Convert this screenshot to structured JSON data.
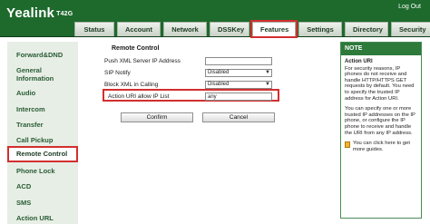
{
  "header": {
    "brand": "Yealink",
    "model": "T42G",
    "logout": "Log Out",
    "tabs": [
      {
        "label": "Status"
      },
      {
        "label": "Account"
      },
      {
        "label": "Network"
      },
      {
        "label": "DSSKey"
      },
      {
        "label": "Features",
        "active": true
      },
      {
        "label": "Settings"
      },
      {
        "label": "Directory"
      },
      {
        "label": "Security"
      }
    ]
  },
  "sidebar": {
    "items": [
      {
        "label": "Forward&DND"
      },
      {
        "label": "General Information"
      },
      {
        "label": "Audio"
      },
      {
        "label": "Intercom"
      },
      {
        "label": "Transfer"
      },
      {
        "label": "Call Pickup"
      },
      {
        "label": "Remote Control",
        "active": true
      },
      {
        "label": "Phone Lock"
      },
      {
        "label": "ACD"
      },
      {
        "label": "SMS"
      },
      {
        "label": "Action URL"
      }
    ]
  },
  "main": {
    "section_title": "Remote Control",
    "fields": {
      "push_xml_label": "Push XML Server IP Address",
      "push_xml_value": "",
      "sip_notify_label": "SIP Notify",
      "sip_notify_value": "Disabled",
      "block_xml_label": "Block XML in Calling",
      "block_xml_value": "Disabled",
      "action_uri_label": "Action URI allow IP List",
      "action_uri_value": "any"
    },
    "confirm_label": "Confirm",
    "cancel_label": "Cancel"
  },
  "note": {
    "header": "NOTE",
    "title": "Action URI",
    "para1": "For security reasons, IP phones do not receive and handle HTTP/HTTPS GET requests by default. You need to specify the trusted IP address for Action URI.",
    "para2": "You can specify one or more trusted IP addresses on the IP phone, or configure the IP phone to receive and handle the URI from any IP address.",
    "link": "You can click here to get more guides."
  },
  "colors": {
    "header_green": "#1d6a2c",
    "highlight_red": "#d32f2f",
    "sidebar_bg": "#e7eee6"
  }
}
